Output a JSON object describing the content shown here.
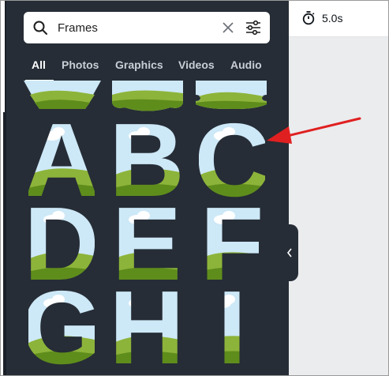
{
  "search": {
    "value": "Frames",
    "clear_icon": "close-icon",
    "filter_icon": "sliders-icon"
  },
  "tabs": [
    {
      "label": "All",
      "active": true
    },
    {
      "label": "Photos",
      "active": false
    },
    {
      "label": "Graphics",
      "active": false
    },
    {
      "label": "Videos",
      "active": false
    },
    {
      "label": "Audio",
      "active": false
    }
  ],
  "frames": [
    {
      "letter": "A"
    },
    {
      "letter": "B"
    },
    {
      "letter": "C"
    },
    {
      "letter": "D"
    },
    {
      "letter": "E"
    },
    {
      "letter": "F"
    },
    {
      "letter": "G"
    },
    {
      "letter": "H"
    },
    {
      "letter": "I"
    }
  ],
  "timeline": {
    "duration": "5.0s",
    "timer_icon": "stopwatch-icon"
  },
  "annotation": {
    "color": "#e02020"
  },
  "colors": {
    "panel": "#262d36",
    "sky": "#cde8f7",
    "grass": "#8db43a",
    "grass_dark": "#5f8d1c",
    "canvas": "#ebecee"
  }
}
